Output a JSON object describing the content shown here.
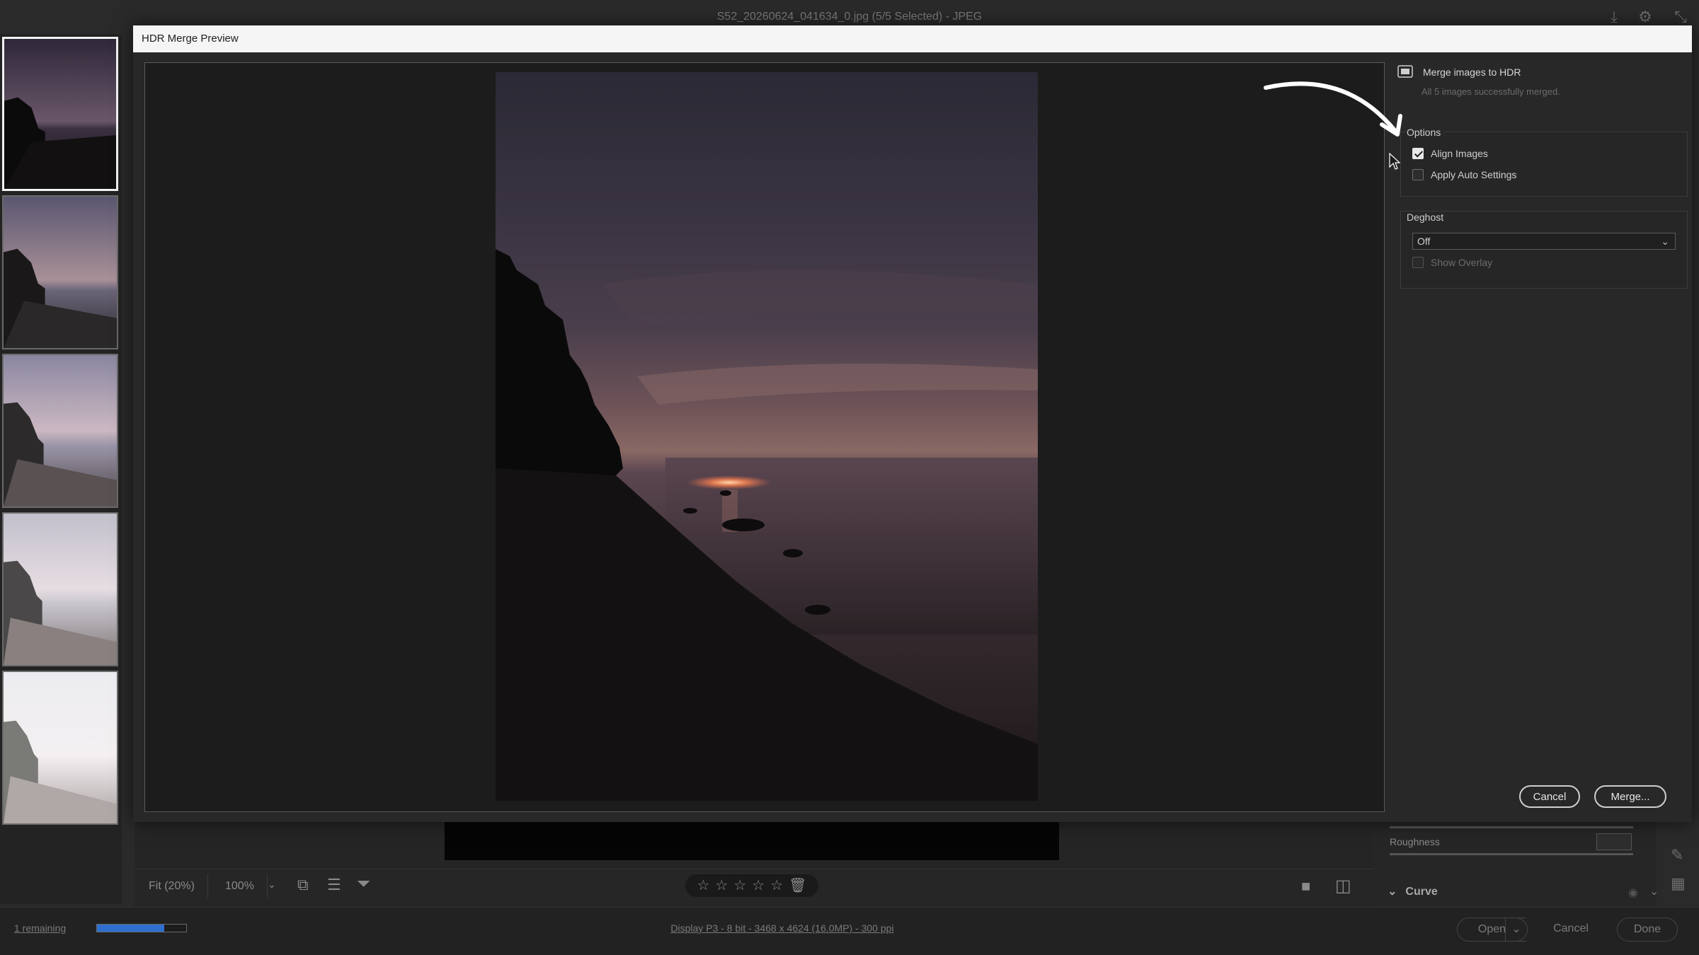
{
  "app": {
    "title": "S52_20260624_041634_0.jpg (5/5 Selected)  -  JPEG"
  },
  "filmstrip": {
    "thumbnails": [
      {
        "label": "exposure-1",
        "selected": true
      },
      {
        "label": "exposure-2",
        "selected": false
      },
      {
        "label": "exposure-3",
        "selected": false
      },
      {
        "label": "exposure-4",
        "selected": false
      },
      {
        "label": "exposure-5",
        "selected": false
      }
    ]
  },
  "dialog": {
    "title": "HDR Merge Preview",
    "merge_heading": "Merge images to HDR",
    "merge_status": "All 5 images successfully merged.",
    "options": {
      "title": "Options",
      "align_images": {
        "label": "Align Images",
        "checked": true
      },
      "apply_auto_settings": {
        "label": "Apply Auto Settings",
        "checked": false
      }
    },
    "deghost": {
      "title": "Deghost",
      "value": "Off",
      "show_overlay": {
        "label": "Show Overlay",
        "checked": false,
        "disabled": true
      }
    },
    "cancel_label": "Cancel",
    "merge_label": "Merge..."
  },
  "view_toolbar": {
    "fit_label": "Fit (20%)",
    "zoom_label": "100%",
    "rating_stars": "☆☆☆☆☆"
  },
  "right_panel_bg": {
    "roughness_label": "Roughness",
    "curve_label": "Curve"
  },
  "status_bar": {
    "remaining": "1 remaining",
    "progress": 0.75,
    "file_info": "Display P3 - 8 bit - 3468 x 4624 (16.0MP) - 300 ppi",
    "open_label": "Open",
    "cancel_label": "Cancel",
    "done_label": "Done"
  },
  "colors": {
    "accent": "#2e6fd0",
    "dialog_titlebar": "#f5f5f5",
    "background": "#2a2a2a"
  }
}
